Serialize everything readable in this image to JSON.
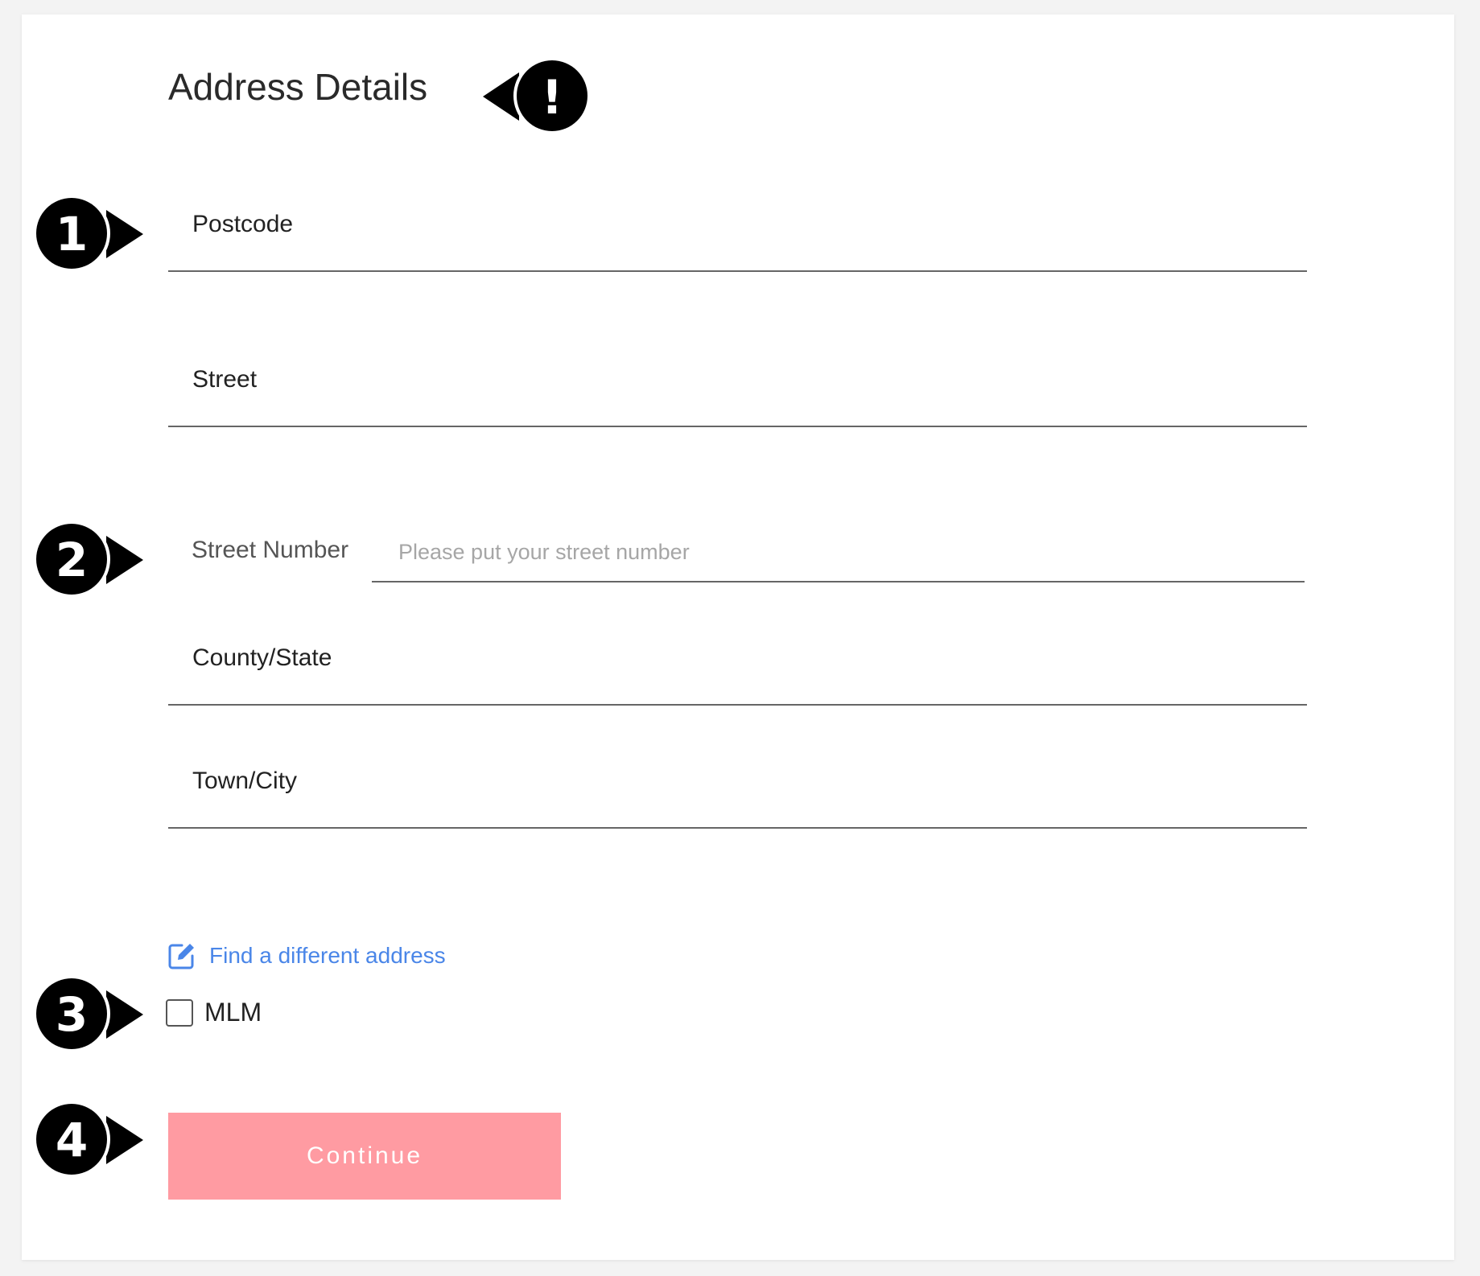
{
  "form": {
    "title": "Address Details",
    "fields": {
      "postcode": {
        "label": "Postcode"
      },
      "street": {
        "label": "Street"
      },
      "street_number": {
        "label": "Street Number",
        "placeholder": "Please put your street number"
      },
      "county_state": {
        "label": "County/State"
      },
      "town_city": {
        "label": "Town/City"
      }
    },
    "find_address_link": "Find a different address",
    "checkbox": {
      "label": "MLM",
      "checked": false
    },
    "continue_button": "Continue"
  },
  "annotations": {
    "title_marker": "!",
    "markers": [
      "1",
      "2",
      "3",
      "4"
    ]
  },
  "colors": {
    "link": "#4a86e8",
    "button": "#ff9ba2",
    "marker": "#000000"
  }
}
